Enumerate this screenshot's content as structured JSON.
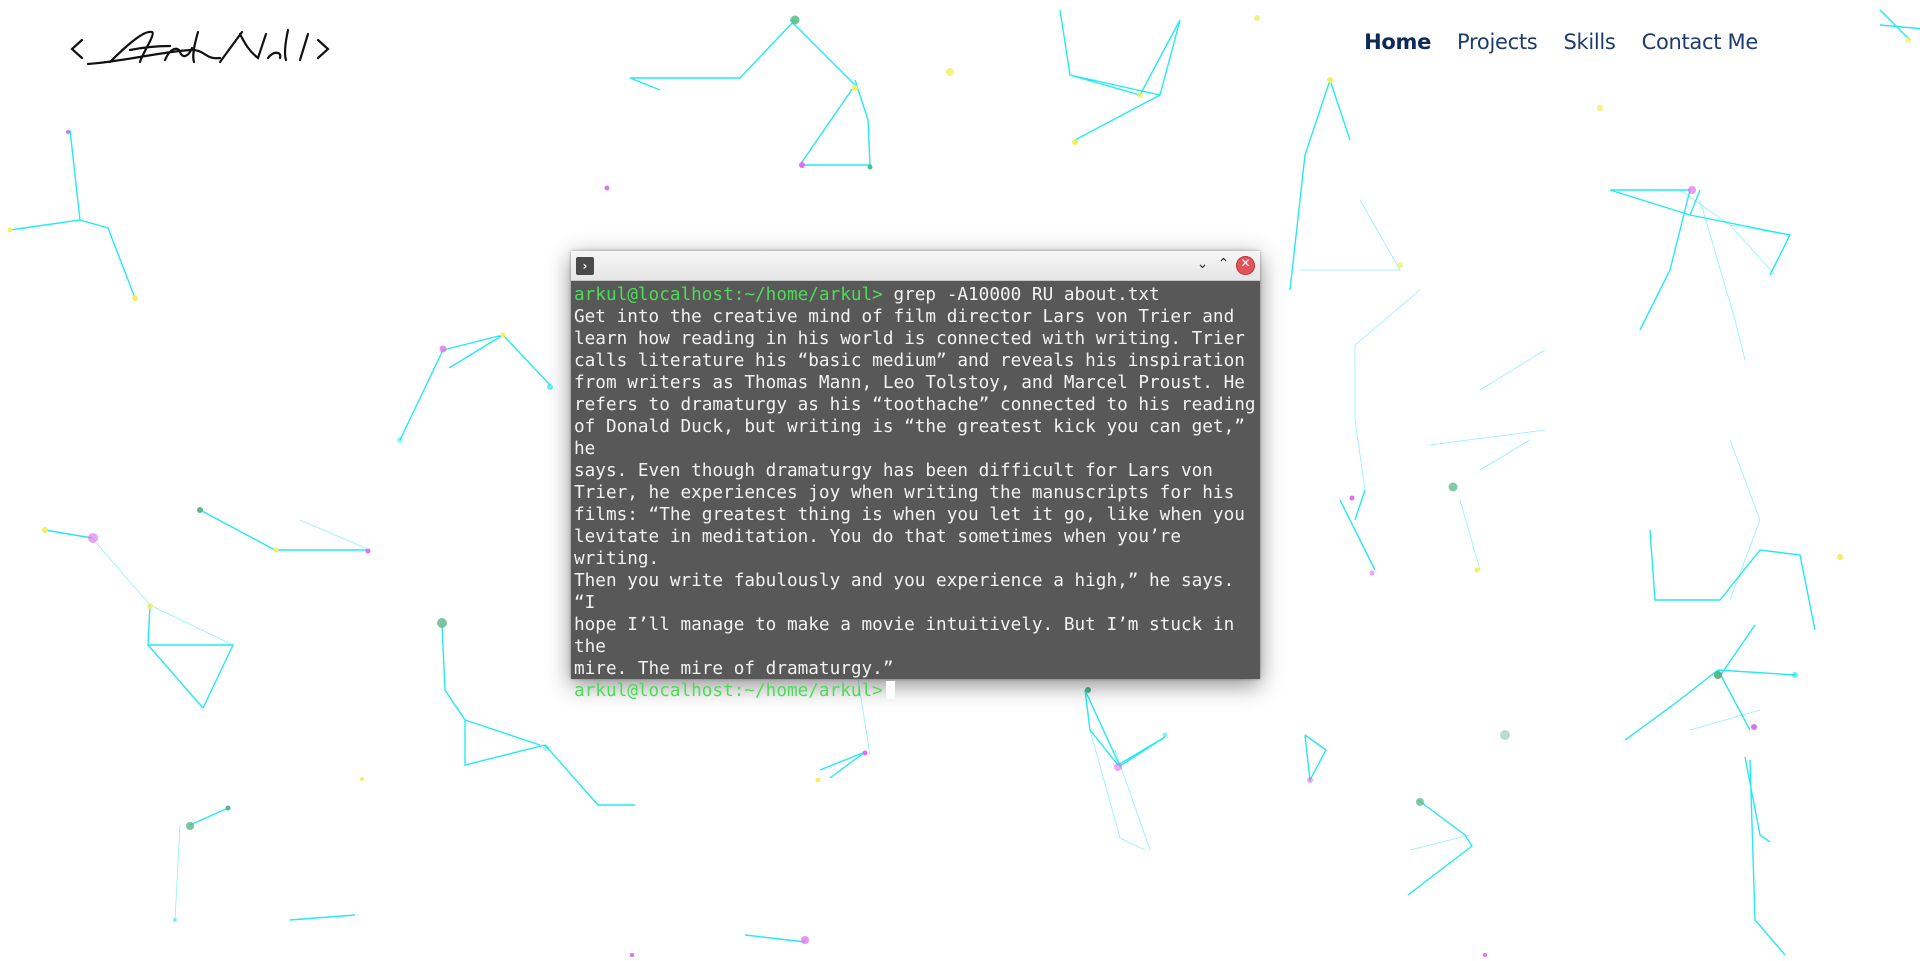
{
  "logo": {
    "text": "<Arkul Nell/>"
  },
  "nav": {
    "items": [
      {
        "label": "Home",
        "active": true
      },
      {
        "label": "Projects",
        "active": false
      },
      {
        "label": "Skills",
        "active": false
      },
      {
        "label": "Contact Me",
        "active": false
      }
    ]
  },
  "terminal": {
    "prompt": "arkul@localhost:~/home/arkul>",
    "command": "grep -A10000 RU about.txt",
    "output_lines": [
      "Get into the creative mind of film director Lars von Trier and",
      "learn how reading in his world is connected with writing. Trier",
      "calls literature his “basic medium” and reveals his inspiration",
      "from writers as Thomas Mann, Leo Tolstoy, and Marcel Proust. He",
      "refers to dramaturgy as his “toothache” connected to his reading",
      "of Donald Duck, but writing is “the greatest kick you can get,” he",
      "says. Even though dramaturgy has been difficult for Lars von",
      "Trier, he experiences joy when writing the manuscripts for his",
      "films: “The greatest thing is when you let it go, like when you",
      "levitate in meditation. You do that sometimes when you’re writing.",
      "Then you write fabulously and you experience a high,” he says. “I",
      "hope I’ll manage to make a movie intuitively. But I’m stuck in the",
      "mire. The mire of dramaturgy.”"
    ],
    "icons": {
      "terminal": "terminal-icon",
      "minimize": "chevron-down-icon",
      "maximize": "chevron-up-icon",
      "close": "close-icon"
    }
  },
  "colors": {
    "nav_text": "#1d3c6e",
    "terminal_bg": "#585858",
    "prompt": "#4ddc57",
    "particle_line": "#00e5f0",
    "particle_yellow": "#f0f060",
    "particle_magenta": "#e070f0",
    "particle_green": "#5ab88a",
    "close_button": "#e0545a"
  }
}
